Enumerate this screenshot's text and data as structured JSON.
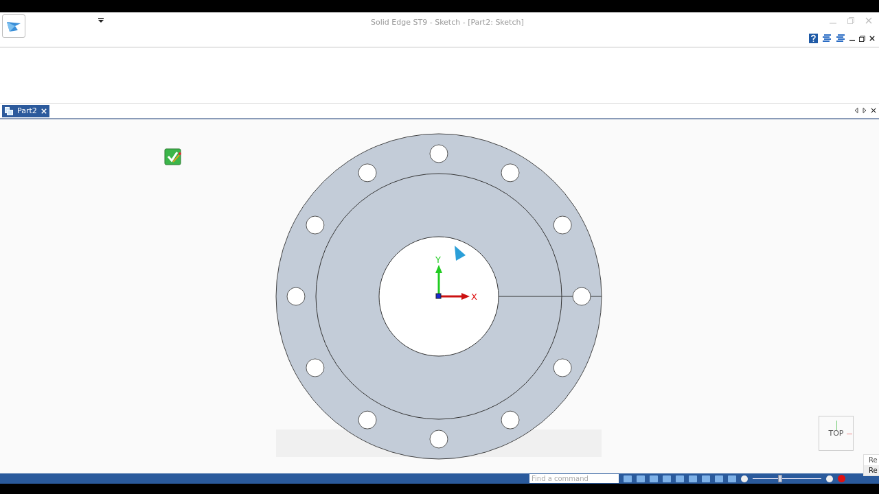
{
  "window": {
    "title": "Solid Edge ST9 - Sketch - [Part2: Sketch]"
  },
  "tabs": [
    {
      "label": "Part2",
      "selected": true
    }
  ],
  "axes": {
    "y_label": "Y",
    "x_label": "X"
  },
  "view_cube": {
    "label": "TOP"
  },
  "popup": {
    "items": [
      "Re",
      "Re"
    ]
  },
  "status_bar": {
    "search": {
      "placeholder": "Find a command"
    },
    "zoom": {
      "level": 0.4
    }
  }
}
